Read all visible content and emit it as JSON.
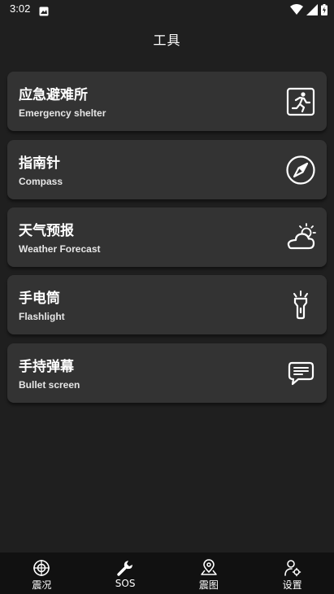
{
  "status_bar": {
    "time": "3:02"
  },
  "header": {
    "title": "工具"
  },
  "tools": [
    {
      "title": "应急避难所",
      "subtitle": "Emergency shelter",
      "icon": "emergency-exit-icon"
    },
    {
      "title": "指南针",
      "subtitle": "Compass",
      "icon": "compass-icon"
    },
    {
      "title": "天气预报",
      "subtitle": "Weather Forecast",
      "icon": "weather-icon"
    },
    {
      "title": "手电筒",
      "subtitle": "Flashlight",
      "icon": "flashlight-icon"
    },
    {
      "title": "手持弹幕",
      "subtitle": "Bullet screen",
      "icon": "message-icon"
    }
  ],
  "bottom_nav": [
    {
      "label": "震况",
      "icon": "target-icon"
    },
    {
      "label": "SOS",
      "icon": "wrench-icon",
      "active": true
    },
    {
      "label": "震图",
      "icon": "map-pin-icon"
    },
    {
      "label": "设置",
      "icon": "user-settings-icon"
    }
  ]
}
